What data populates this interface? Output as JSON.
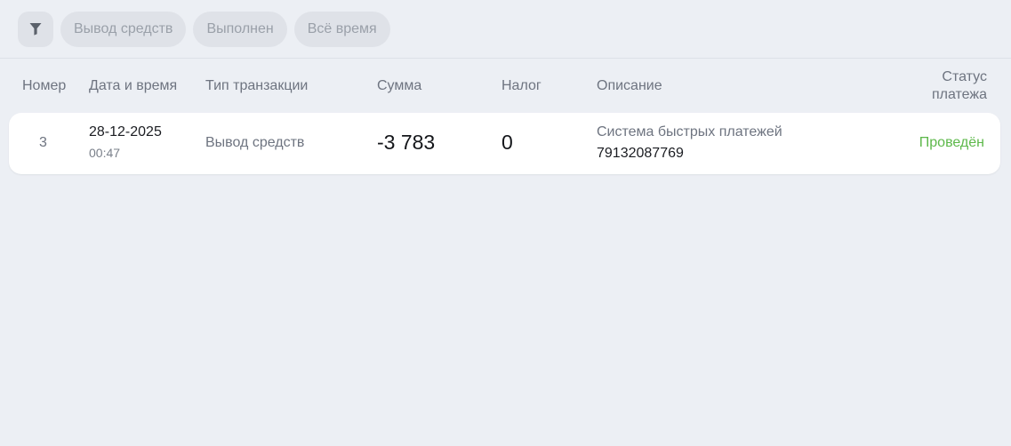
{
  "filters": {
    "chips": [
      "Вывод средств",
      "Выполнен",
      "Всё время"
    ]
  },
  "icons": {
    "filter": "filter-funnel-icon"
  },
  "colors": {
    "background": "#eceff4",
    "chip_bg": "#dfe2e8",
    "status_success": "#5db84a"
  },
  "table": {
    "headers": {
      "number": "Номер",
      "datetime": "Дата и время",
      "type": "Тип транзакции",
      "sum": "Сумма",
      "tax": "Налог",
      "description": "Описание",
      "status_line1": "Статус",
      "status_line2": "платежа"
    },
    "rows": [
      {
        "number": "3",
        "date": "28-12-2025",
        "time": "00:47",
        "type": "Вывод средств",
        "sum": "-3 783",
        "tax": "0",
        "description": "Система быстрых платежей",
        "account": "79132087769",
        "status": "Проведён"
      }
    ]
  }
}
